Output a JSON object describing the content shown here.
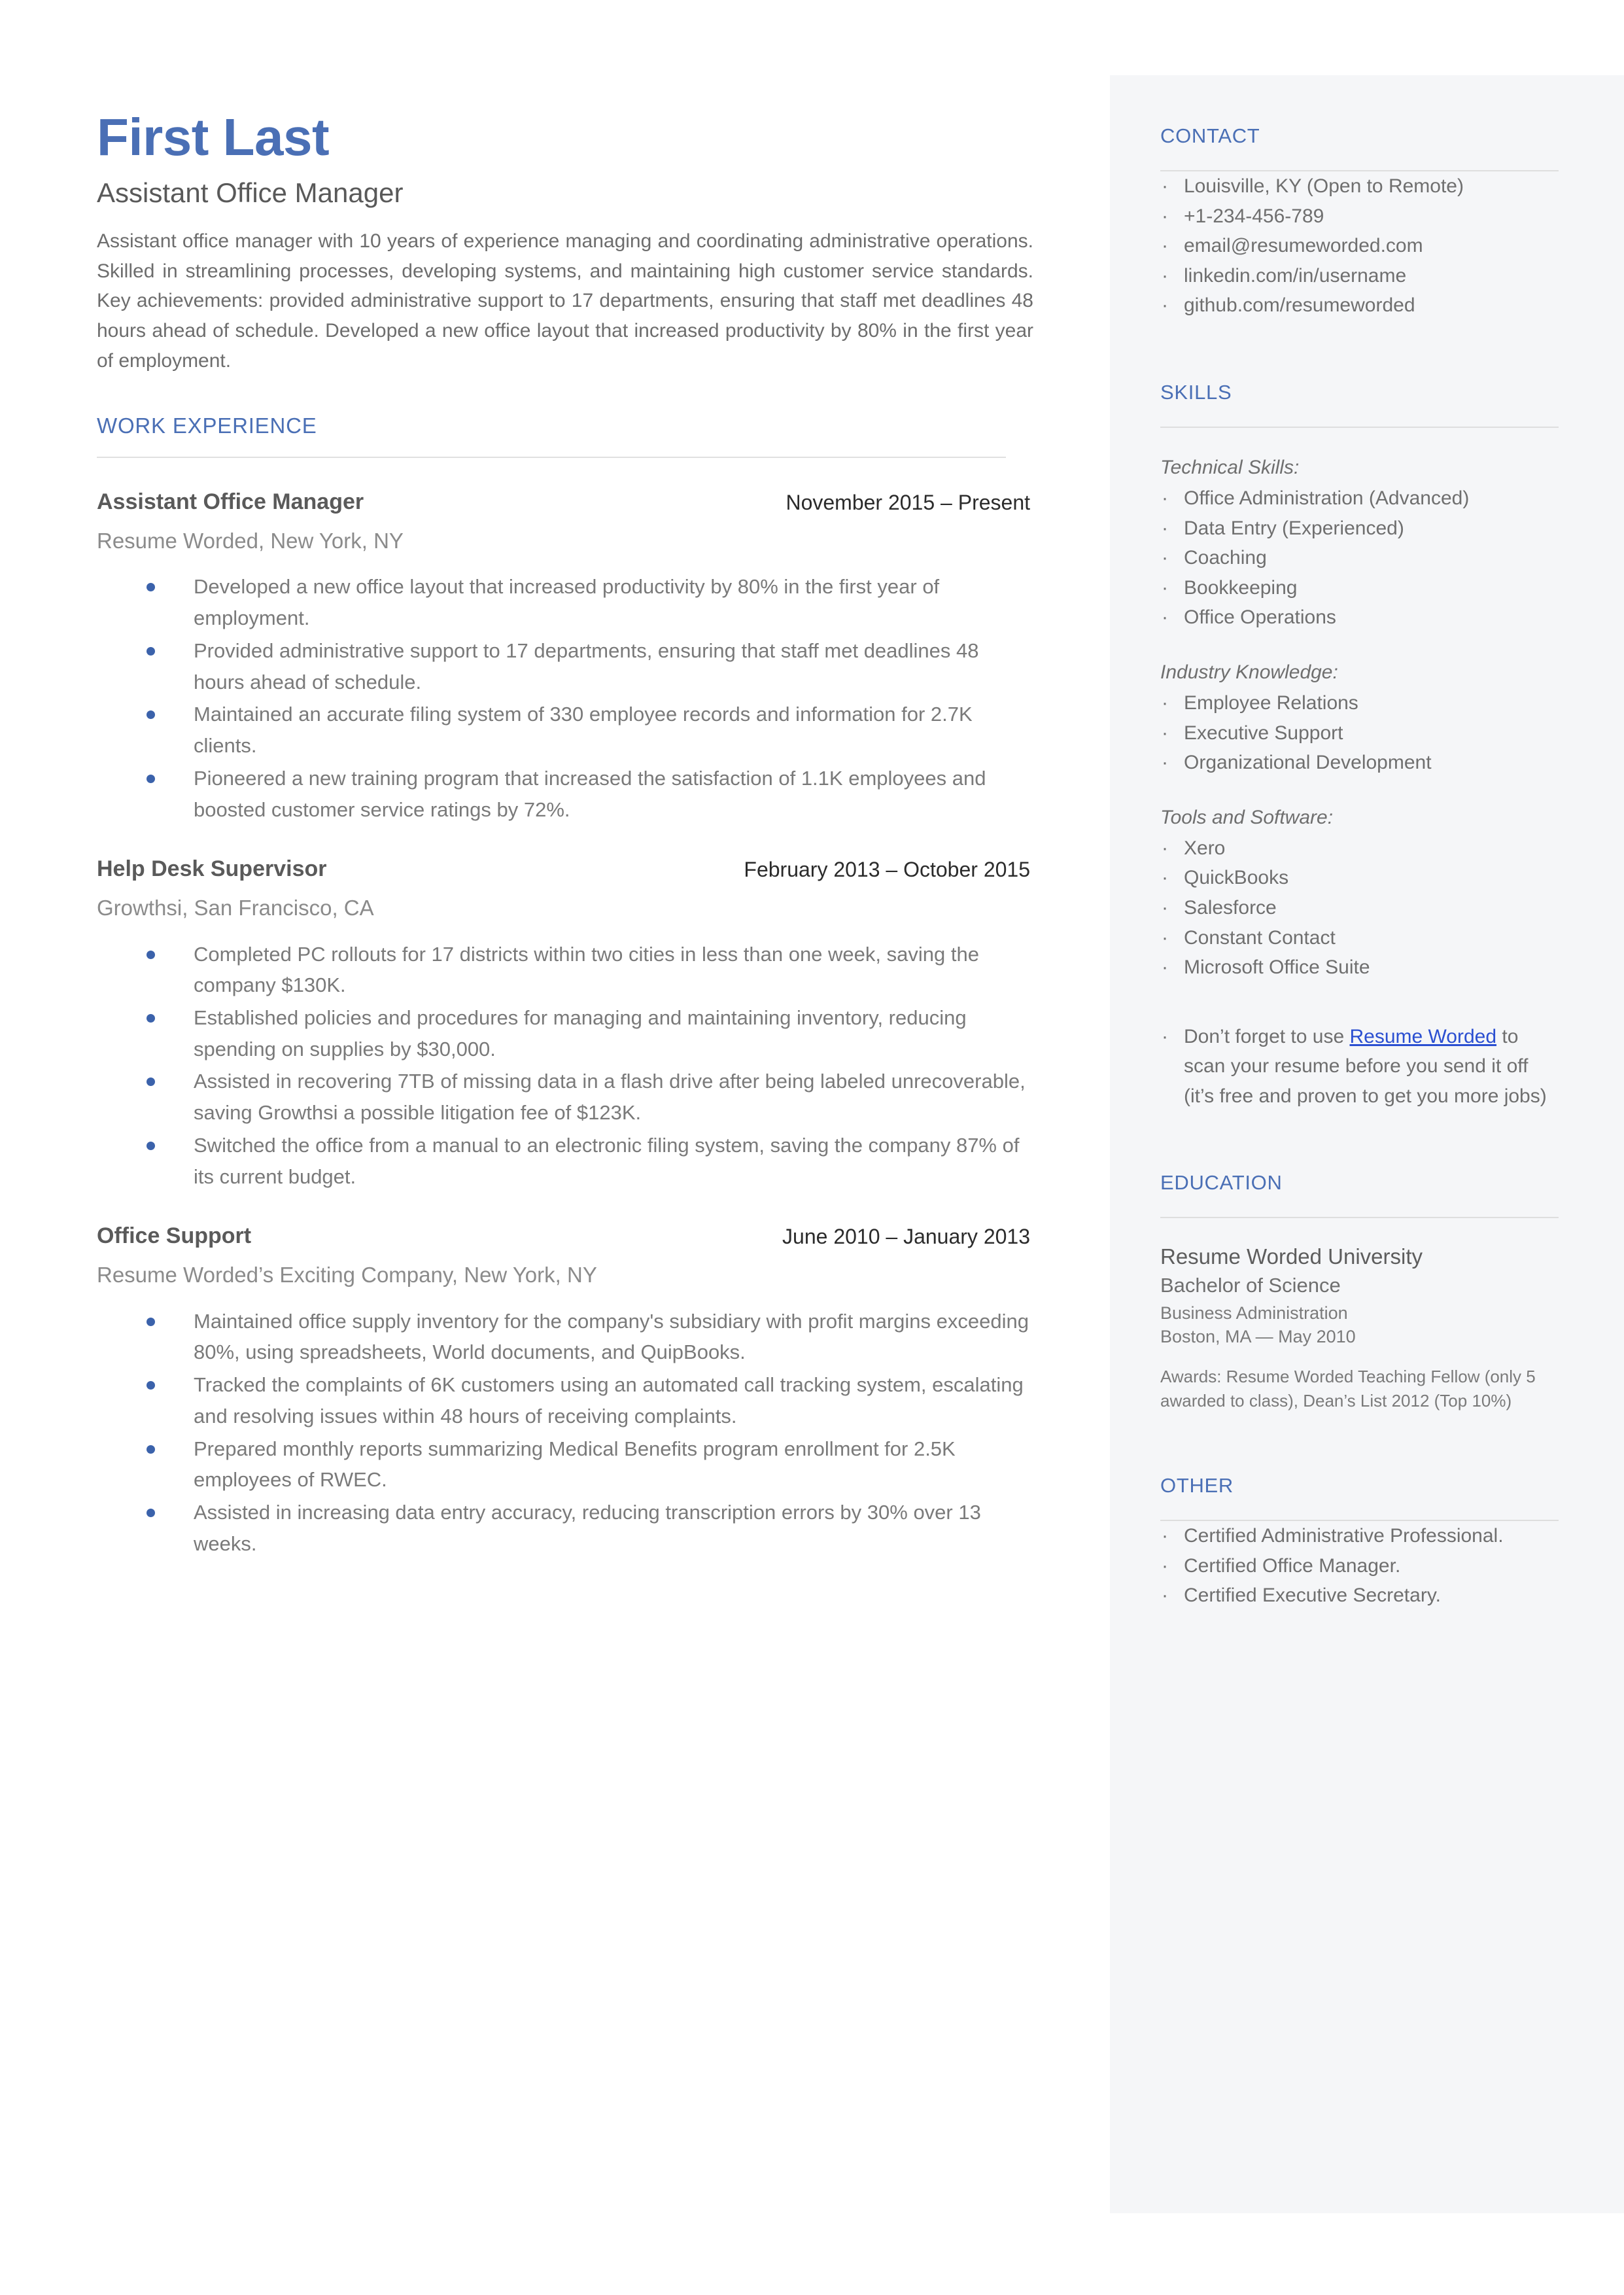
{
  "colors": {
    "accent_blue": "#4a6fb5",
    "bullet_blue": "#3b62ab",
    "link_blue": "#2b4fd1",
    "sidebar_bg": "#f5f6f8",
    "body_text": "#7a7a7a"
  },
  "header": {
    "name": "First Last",
    "title": "Assistant Office Manager",
    "summary": "Assistant office manager with 10 years of experience managing and coordinating administrative operations. Skilled in streamlining processes, developing systems, and maintaining high customer service standards. Key achievements: provided administrative support to 17 departments, ensuring that staff met deadlines 48 hours ahead of schedule. Developed a new office layout that increased productivity by 80% in the first year of employment."
  },
  "work_experience": {
    "heading": "WORK EXPERIENCE",
    "jobs": [
      {
        "role": "Assistant Office Manager",
        "dates": "November 2015 – Present",
        "company": "Resume Worded, New York, NY",
        "bullets": [
          "Developed a new office layout that increased productivity by 80% in the first year of employment.",
          "Provided administrative support to 17 departments, ensuring that staff met deadlines 48 hours ahead of schedule.",
          "Maintained an accurate filing system of 330 employee records and information for 2.7K clients.",
          "Pioneered a new training program that increased the satisfaction of 1.1K employees and boosted customer service ratings by 72%."
        ]
      },
      {
        "role": "Help Desk Supervisor",
        "dates": "February 2013 – October 2015",
        "company": "Growthsi, San Francisco, CA",
        "bullets": [
          "Completed PC rollouts for 17 districts within two cities in less than one week, saving the company $130K.",
          "Established policies and procedures for managing and maintaining inventory, reducing spending on supplies by $30,000.",
          "Assisted in recovering 7TB of missing data in a flash drive after being labeled unrecoverable, saving Growthsi a possible litigation fee of $123K.",
          "Switched the office from a manual to an electronic filing system, saving the company 87% of its current budget."
        ]
      },
      {
        "role": "Office Support",
        "dates": "June 2010 – January 2013",
        "company": "Resume Worded’s Exciting Company, New York, NY",
        "bullets": [
          "Maintained office supply inventory for the company's subsidiary with profit margins exceeding 80%, using spreadsheets, World documents, and QuipBooks.",
          "Tracked the complaints of 6K customers using an automated call tracking system, escalating and resolving issues within 48 hours of receiving complaints.",
          "Prepared monthly reports summarizing Medical Benefits program enrollment for 2.5K employees of RWEC.",
          "Assisted in increasing data entry accuracy, reducing transcription errors by 30% over 13 weeks."
        ]
      }
    ]
  },
  "sidebar": {
    "contact": {
      "heading": "CONTACT",
      "items": [
        "Louisville, KY (Open to Remote)",
        "+1-234-456-789",
        "email@resumeworded.com",
        "linkedin.com/in/username",
        "github.com/resumeworded"
      ]
    },
    "skills": {
      "heading": "SKILLS",
      "groups": [
        {
          "label": "Technical Skills:",
          "items": [
            "Office Administration (Advanced)",
            "Data Entry (Experienced)",
            "Coaching",
            "Bookkeeping",
            "Office Operations"
          ]
        },
        {
          "label": "Industry Knowledge:",
          "items": [
            "Employee Relations",
            "Executive Support",
            "Organizational Development"
          ]
        },
        {
          "label": "Tools and Software:",
          "items": [
            "Xero",
            "QuickBooks",
            "Salesforce",
            "Constant Contact",
            "Microsoft Office Suite"
          ]
        }
      ],
      "promo": {
        "before": "Don’t forget to use ",
        "link": "Resume Worded",
        "after": " to scan your resume before you send it off (it’s free and proven to get you more jobs)"
      }
    },
    "education": {
      "heading": "EDUCATION",
      "school": "Resume Worded University",
      "degree": "Bachelor of Science",
      "field": "Business Administration",
      "location": "Boston, MA — May 2010",
      "awards": "Awards: Resume Worded Teaching Fellow (only 5 awarded to class), Dean’s List 2012 (Top 10%)"
    },
    "other": {
      "heading": "OTHER",
      "items": [
        "Certified Administrative Professional.",
        "Certified Office Manager.",
        "Certified Executive Secretary."
      ]
    }
  },
  "glyphs": {
    "small_bullet": "·"
  }
}
